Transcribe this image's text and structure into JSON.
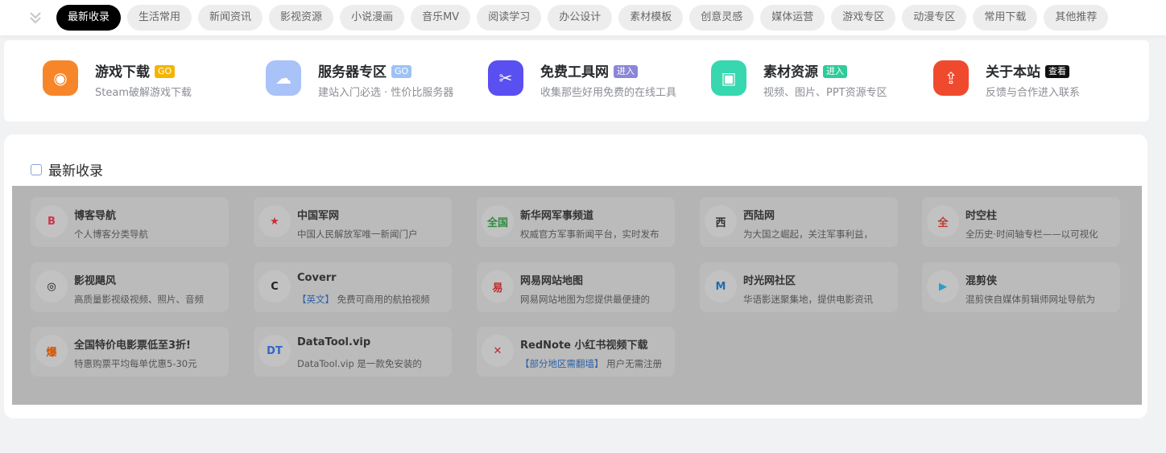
{
  "nav": {
    "tabs": [
      "最新收录",
      "生活常用",
      "新闻资讯",
      "影视资源",
      "小说漫画",
      "音乐MV",
      "阅读学习",
      "办公设计",
      "素材模板",
      "创意灵感",
      "媒体运营",
      "游戏专区",
      "动漫专区",
      "常用下载",
      "其他推荐"
    ],
    "active_index": 0,
    "collapse_icon": "double-chevron-down-icon"
  },
  "featured": [
    {
      "title": "游戏下载",
      "badge": "GO",
      "badge_color": "#f5b400",
      "desc": "Steam破解游戏下载",
      "icon": "gamepad-icon",
      "icon_color": "#f7862a"
    },
    {
      "title": "服务器专区",
      "badge": "GO",
      "badge_color": "#9dc3f5",
      "desc": "建站入门必选 · 性价比服务器",
      "icon": "cloud-icon",
      "icon_color": "#a9c2f8"
    },
    {
      "title": "免费工具网",
      "badge": "进入",
      "badge_color": "#8c86d8",
      "desc": "收集那些好用免费的在线工具",
      "icon": "tools-icon",
      "icon_color": "#5a4ff0"
    },
    {
      "title": "素材资源",
      "badge": "进入",
      "badge_color": "#2ecc9a",
      "desc": "视频、图片、PPT资源专区",
      "icon": "media-icon",
      "icon_color": "#37d7b0"
    },
    {
      "title": "关于本站",
      "badge": "查看",
      "badge_color": "#111111",
      "desc": "反馈与合作进入联系",
      "icon": "share-icon",
      "icon_color": "#f04a2e"
    }
  ],
  "section": {
    "title": "最新收录",
    "icon": "folder-icon"
  },
  "cards": [
    {
      "title": "博客导航",
      "desc": "个人博客分类导航",
      "tag": "",
      "icon": "blog-logo-icon",
      "glyph": "B",
      "color": "#d0334a"
    },
    {
      "title": "中国军网",
      "desc": "中国人民解放军唯一新闻门户",
      "tag": "",
      "icon": "army-logo-icon",
      "glyph": "★",
      "color": "#c72e2e"
    },
    {
      "title": "新华网军事频道",
      "desc": "权威官方军事新闻平台，实时发布",
      "tag": "",
      "icon": "xinhua-logo-icon",
      "glyph": "全国",
      "color": "#2e8b3d"
    },
    {
      "title": "西陆网",
      "desc": "为大国之崛起，关注军事利益，",
      "tag": "",
      "icon": "xilu-logo-icon",
      "glyph": "西",
      "color": "#333333"
    },
    {
      "title": "时空柱",
      "desc": "全历史·时间轴专栏——以可视化",
      "tag": "",
      "icon": "history-logo-icon",
      "glyph": "全",
      "color": "#c0392b"
    },
    {
      "title": "影视飓风",
      "desc": "高质量影视级视频、照片、音频",
      "tag": "",
      "icon": "tornado-logo-icon",
      "glyph": "◎",
      "color": "#111111"
    },
    {
      "title": "Coverr",
      "desc": "免费可商用的航拍视频",
      "tag": "【英文】",
      "icon": "coverr-logo-icon",
      "glyph": "C",
      "color": "#222222"
    },
    {
      "title": "网易网站地图",
      "desc": "网易网站地图为您提供最便捷的",
      "tag": "",
      "icon": "netease-logo-icon",
      "glyph": "易",
      "color": "#c0292b"
    },
    {
      "title": "时光网社区",
      "desc": "华语影迷聚集地，提供电影资讯",
      "tag": "",
      "icon": "mtime-logo-icon",
      "glyph": "M",
      "color": "#1f6fb2"
    },
    {
      "title": "混剪侠",
      "desc": "混剪侠自媒体剪辑师网址导航为",
      "tag": "",
      "icon": "play-logo-icon",
      "glyph": "▶",
      "color": "#2a9fc4"
    },
    {
      "title": "全国特价电影票低至3折!",
      "desc": "特惠购票平均每单优惠5-30元",
      "tag": "",
      "icon": "popcorn-logo-icon",
      "glyph": "爆",
      "color": "#d35400"
    },
    {
      "title": "DataTool.vip",
      "desc": "DataTool.vip 是一款免安装的",
      "tag": "",
      "icon": "datatool-logo-icon",
      "glyph": "DT",
      "color": "#2f67c8"
    },
    {
      "title": "RedNote 小红书视频下载",
      "desc": "用户无需注册",
      "tag": "【部分地区需翻墙】",
      "icon": "rednote-logo-icon",
      "glyph": "✕",
      "color": "#c8202f"
    }
  ]
}
